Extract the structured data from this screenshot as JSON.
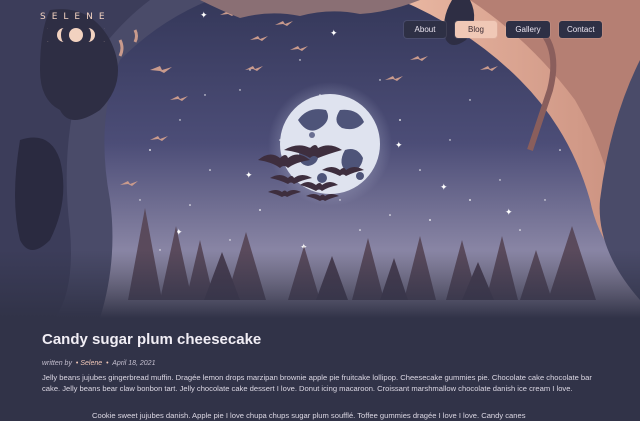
{
  "logo": {
    "text": "SELENE",
    "icon": "moon-phases-icon"
  },
  "nav": {
    "items": [
      {
        "label": "About",
        "active": false
      },
      {
        "label": "Blog",
        "active": true
      },
      {
        "label": "Gallery",
        "active": false
      },
      {
        "label": "Contact",
        "active": false
      }
    ]
  },
  "hero": {
    "illustration": "moonlit-forest-bats-illustration"
  },
  "post": {
    "title": "Candy sugar plum cheesecake",
    "meta_written_by": "written by",
    "meta_author": "Selene",
    "meta_date": "April 18, 2021",
    "paragraph_1": "Jelly beans jujubes gingerbread muffin. Dragée lemon drops marzipan brownie apple pie fruitcake lollipop. Cheesecake gummies pie. Chocolate cake chocolate bar cake. Jelly beans bear claw bonbon tart. Jelly chocolate cake dessert I love. Donut icing macaroon. Croissant marshmallow chocolate danish ice cream I love.",
    "paragraph_2": "Cookie sweet jujubes danish. Apple pie I love chupa chups sugar plum soufflé. Toffee gummies dragée I love I love. Candy canes"
  },
  "colors": {
    "background": "#313348",
    "accent": "#f0c8b6",
    "sky_top": "#3a3a60",
    "sky_bottom": "#8d8aa8"
  }
}
